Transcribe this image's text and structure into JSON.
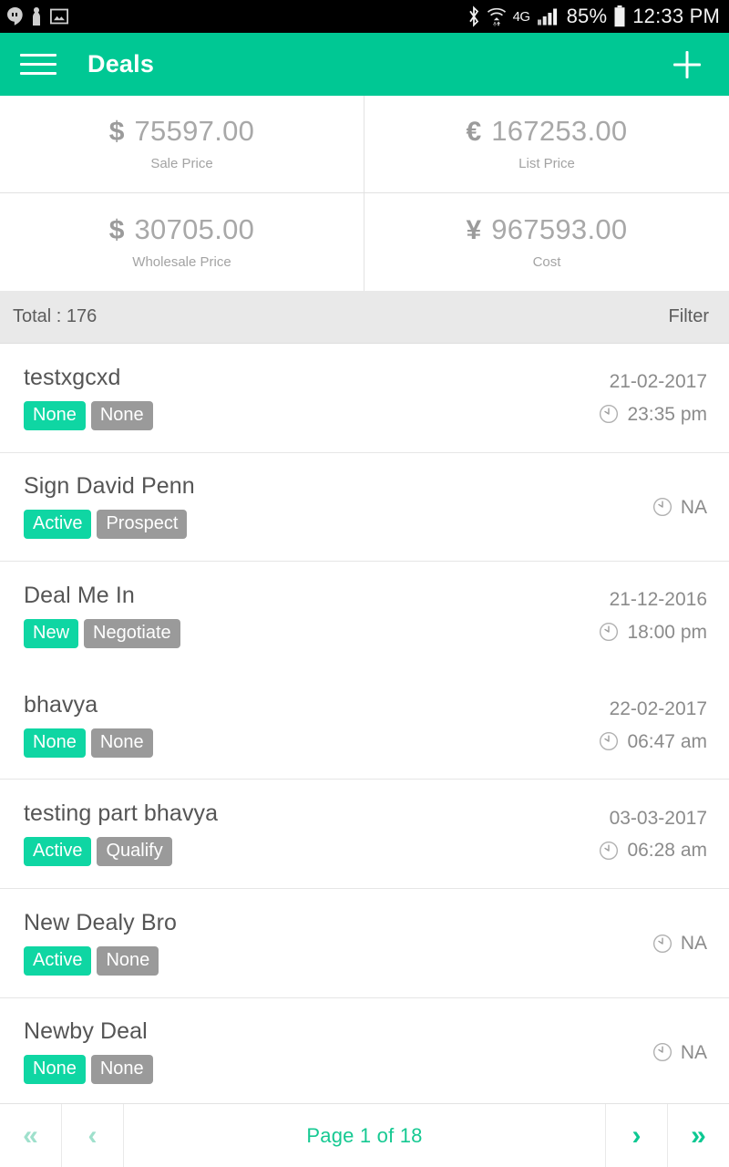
{
  "statusbar": {
    "left_icons": [
      "hangouts-icon",
      "usb-icon",
      "screenshot-icon"
    ],
    "right_icons": [
      "bluetooth-icon",
      "wifi-icon",
      "lte-icon",
      "signal-icon"
    ],
    "network_label": "4G",
    "battery_percent": "85%",
    "time": "12:33 PM"
  },
  "appbar": {
    "menu_icon": "hamburger-icon",
    "title": "Deals",
    "add_icon": "plus-icon",
    "background_color": "#00c894"
  },
  "summary": {
    "cards": [
      {
        "symbol": "$",
        "value": "75597.00",
        "label": "Sale Price"
      },
      {
        "symbol": "€",
        "value": "167253.00",
        "label": "List Price"
      },
      {
        "symbol": "$",
        "value": "30705.00",
        "label": "Wholesale Price"
      },
      {
        "symbol": "¥",
        "value": "967593.00",
        "label": "Cost"
      }
    ]
  },
  "totalbar": {
    "total_label": "Total :  176",
    "filter_label": "Filter"
  },
  "list": {
    "rows": [
      {
        "title": "testxgcxd",
        "badge_primary": "None",
        "badge_secondary": "None",
        "date": "21-02-2017",
        "time": "23:35 pm",
        "clock_icon": "clock-icon",
        "divider": true
      },
      {
        "title": "Sign David Penn",
        "badge_primary": "Active",
        "badge_secondary": "Prospect",
        "date": "",
        "time": "NA",
        "clock_icon": "clock-icon",
        "divider": true
      },
      {
        "title": "Deal Me In",
        "badge_primary": "New",
        "badge_secondary": "Negotiate",
        "date": "21-12-2016",
        "time": "18:00 pm",
        "clock_icon": "clock-icon",
        "divider": false
      },
      {
        "title": "bhavya",
        "badge_primary": "None",
        "badge_secondary": "None",
        "date": "22-02-2017",
        "time": "06:47 am",
        "clock_icon": "clock-icon",
        "divider": true
      },
      {
        "title": "testing part bhavya",
        "badge_primary": "Active",
        "badge_secondary": "Qualify",
        "date": "03-03-2017",
        "time": "06:28 am",
        "clock_icon": "clock-icon",
        "divider": true
      },
      {
        "title": "New Dealy Bro",
        "badge_primary": "Active",
        "badge_secondary": "None",
        "date": "",
        "time": "NA",
        "clock_icon": "clock-icon",
        "divider": true
      },
      {
        "title": "Newby Deal",
        "badge_primary": "None",
        "badge_secondary": "None",
        "date": "",
        "time": "NA",
        "clock_icon": "clock-icon",
        "divider": false
      }
    ]
  },
  "pager": {
    "first_label": "«",
    "prev_label": "‹",
    "page_label": "Page 1 of 18",
    "next_label": "›",
    "last_label": "»",
    "current_page": 1,
    "total_pages": 18,
    "first_enabled": false,
    "prev_enabled": false,
    "next_enabled": true,
    "last_enabled": true
  },
  "colors": {
    "accent_green": "#00c894",
    "badge_green": "#0fd6a3",
    "badge_grey": "#9a9a9a",
    "pager_green": "#0dc892",
    "pager_disabled": "#9fe0cc"
  }
}
